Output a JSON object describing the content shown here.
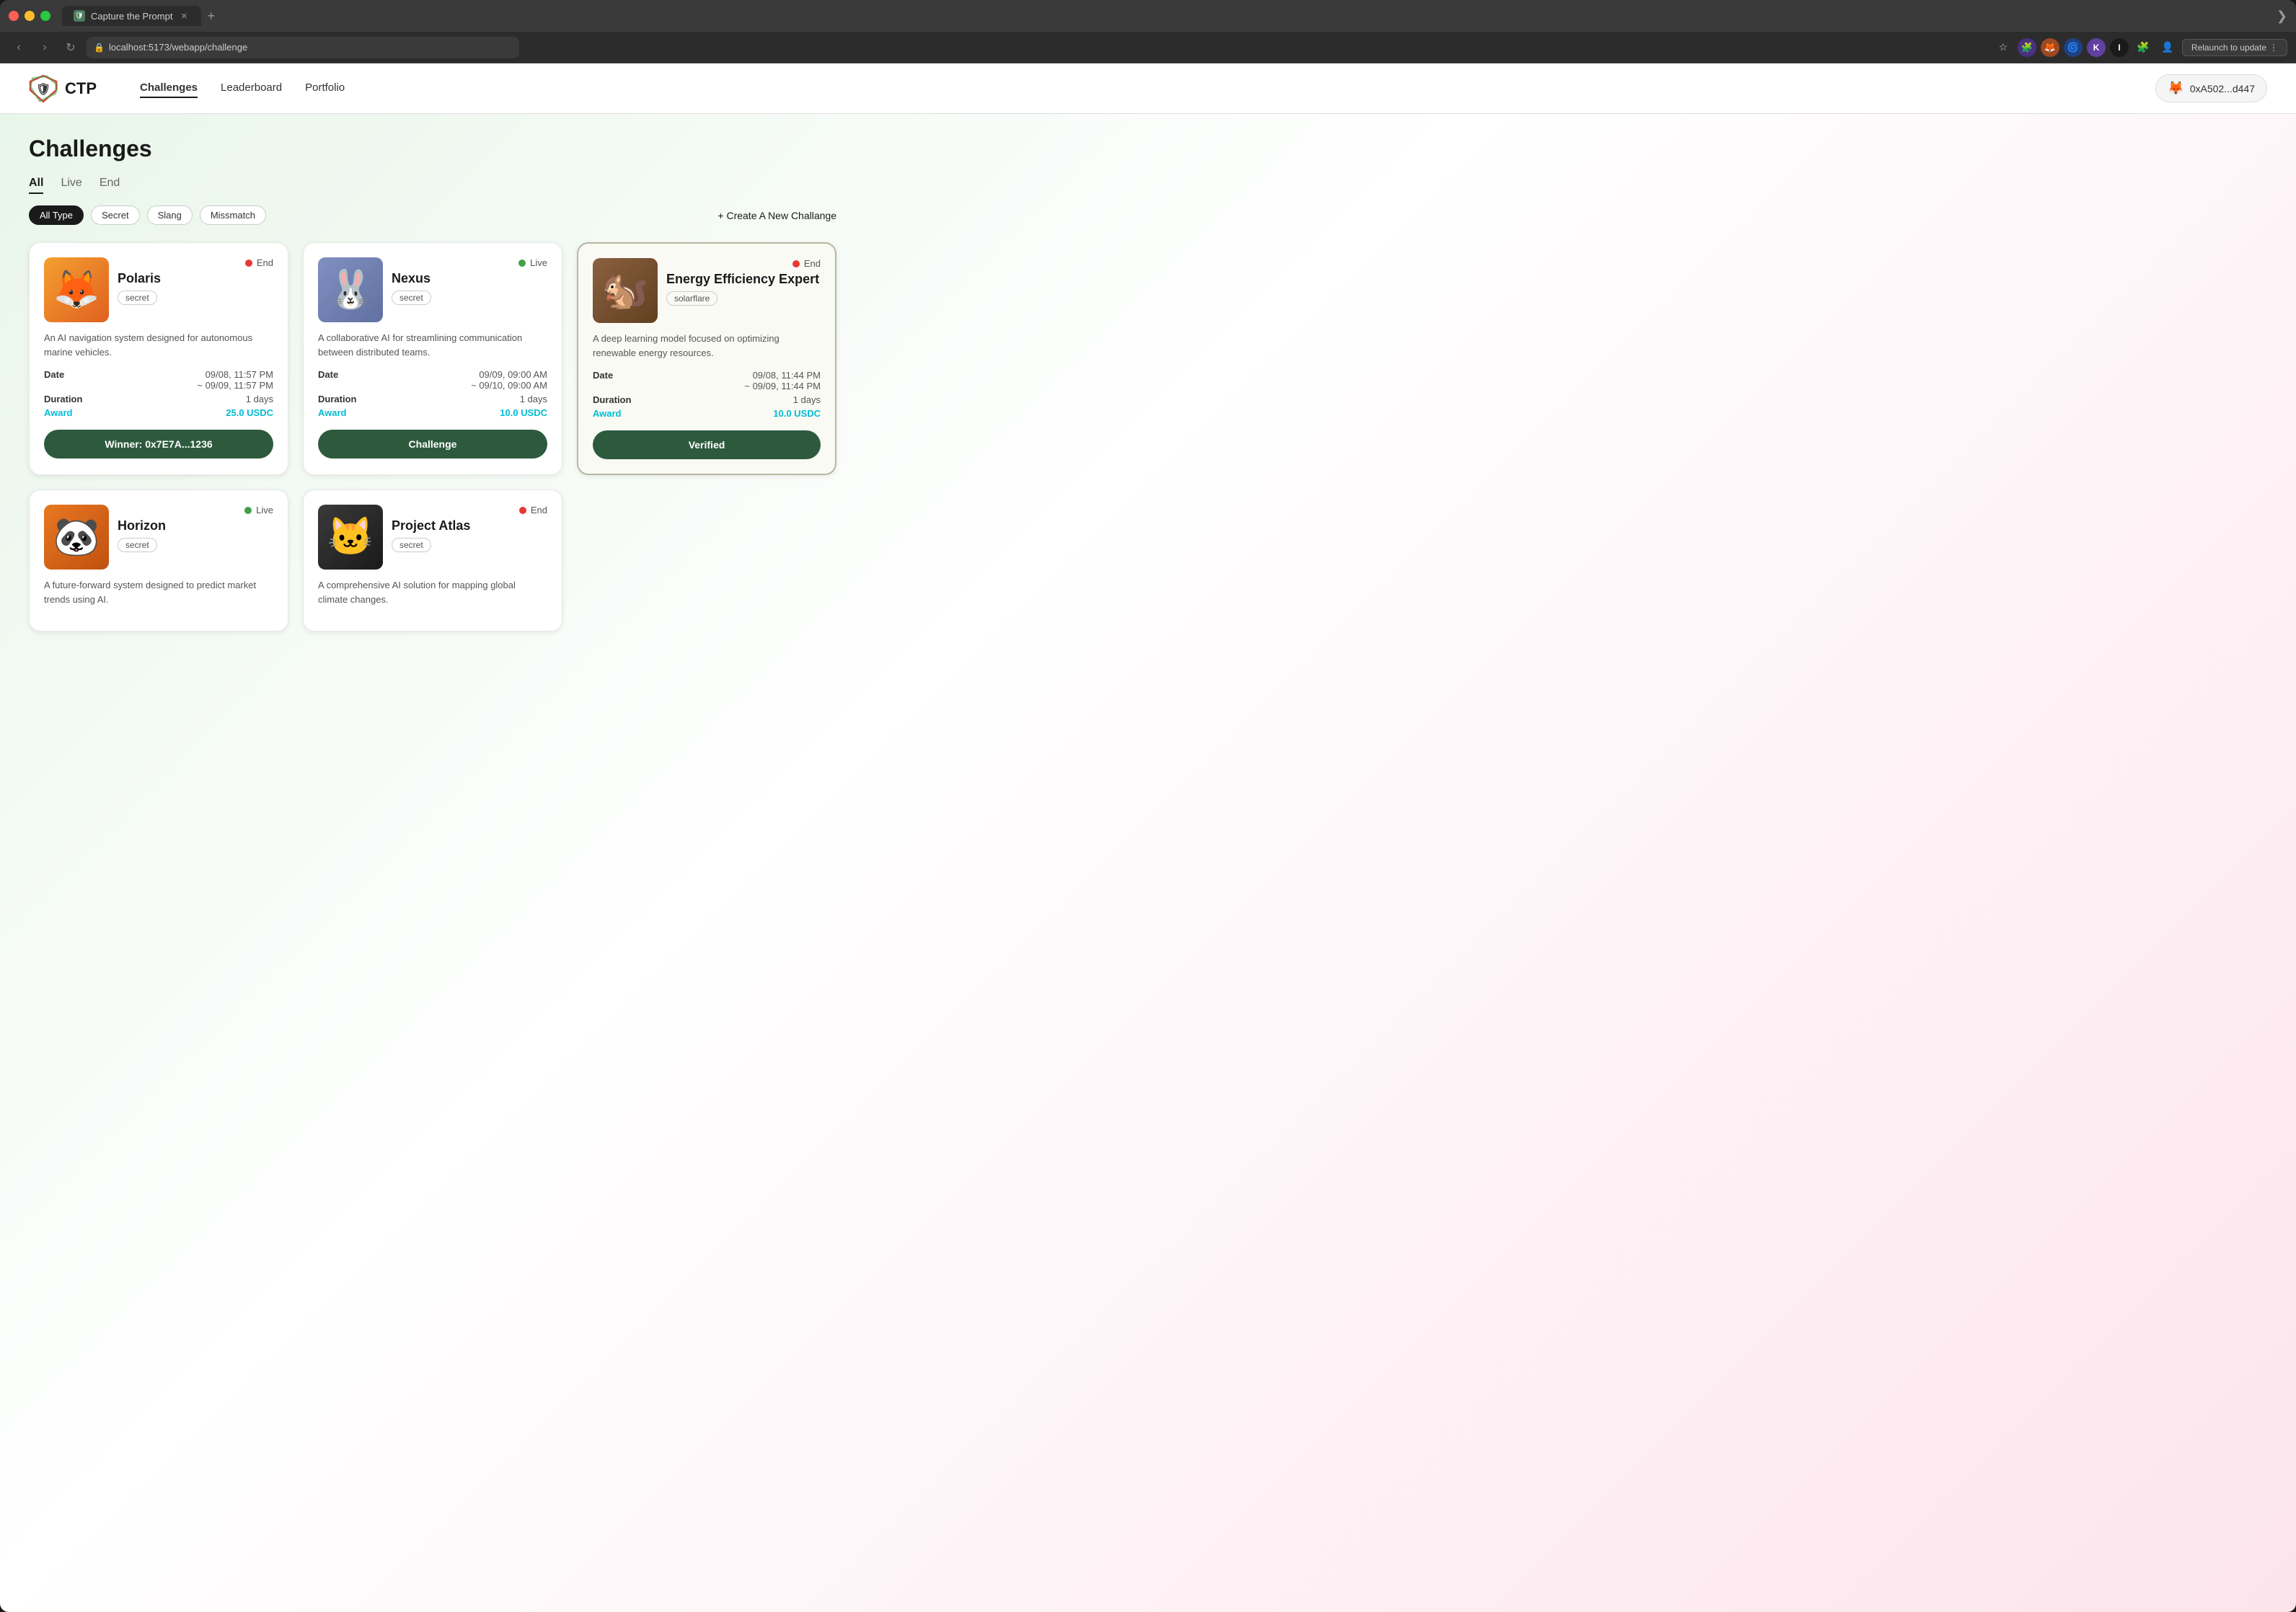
{
  "browser": {
    "tab_title": "Capture the Prompt",
    "url": "localhost:5173/webapp/challenge",
    "relaunch_label": "Relaunch to update",
    "new_tab_symbol": "+",
    "chevron_symbol": "❯"
  },
  "navbar": {
    "logo_text": "CTP",
    "nav_links": [
      {
        "label": "Challenges",
        "active": true
      },
      {
        "label": "Leaderboard",
        "active": false
      },
      {
        "label": "Portfolio",
        "active": false
      }
    ],
    "wallet_address": "0xA502...d447"
  },
  "page": {
    "title": "Challenges",
    "filter_tabs": [
      "All",
      "Live",
      "End"
    ],
    "active_filter": "All",
    "type_filters": [
      "All Type",
      "Secret",
      "Slang",
      "Missmatch"
    ],
    "active_type": "All Type",
    "create_label": "+ Create A New Challange"
  },
  "cards": [
    {
      "id": "polaris",
      "name": "Polaris",
      "badge": "secret",
      "status": "End",
      "status_type": "red",
      "image_emoji": "🦊",
      "image_bg": "orange",
      "description": "An AI navigation system designed for autonomous marine vehicles.",
      "date_start": "09/08, 11:57 PM",
      "date_end": "~ 09/09, 11:57 PM",
      "duration": "1 days",
      "award": "25.0 USDC",
      "action_label": "Winner: 0x7E7A...1236",
      "action_type": "winner",
      "highlighted": false
    },
    {
      "id": "nexus",
      "name": "Nexus",
      "badge": "secret",
      "status": "Live",
      "status_type": "green",
      "image_emoji": "🐰",
      "image_bg": "blue",
      "description": "A collaborative AI for streamlining communication between distributed teams.",
      "date_start": "09/09, 09:00 AM",
      "date_end": "~ 09/10, 09:00 AM",
      "duration": "1 days",
      "award": "10.0 USDC",
      "action_label": "Challenge",
      "action_type": "challenge",
      "highlighted": false
    },
    {
      "id": "energy",
      "name": "Energy Efficiency Expert",
      "badge": "solarflare",
      "status": "End",
      "status_type": "red",
      "image_emoji": "🐿️",
      "image_bg": "brown",
      "description": "A deep learning model focused on optimizing renewable energy resources.",
      "date_start": "09/08, 11:44 PM",
      "date_end": "~ 09/09, 11:44 PM",
      "duration": "1 days",
      "award": "10.0 USDC",
      "action_label": "Verified",
      "action_type": "verified",
      "highlighted": true
    },
    {
      "id": "horizon",
      "name": "Horizon",
      "badge": "secret",
      "status": "Live",
      "status_type": "green",
      "image_emoji": "🐼",
      "image_bg": "orange",
      "description": "A future-forward system designed to predict market trends using AI.",
      "date_start": "",
      "date_end": "",
      "duration": "",
      "award": "",
      "action_label": "",
      "action_type": "",
      "highlighted": false,
      "partial": true
    },
    {
      "id": "atlas",
      "name": "Project Atlas",
      "badge": "secret",
      "status": "End",
      "status_type": "red",
      "image_emoji": "🐱",
      "image_bg": "dark",
      "description": "A comprehensive AI solution for mapping global climate changes.",
      "date_start": "",
      "date_end": "",
      "duration": "",
      "award": "",
      "action_label": "",
      "action_type": "",
      "highlighted": false,
      "partial": true
    }
  ],
  "meta_labels": {
    "date": "Date",
    "duration": "Duration",
    "award": "Award"
  }
}
